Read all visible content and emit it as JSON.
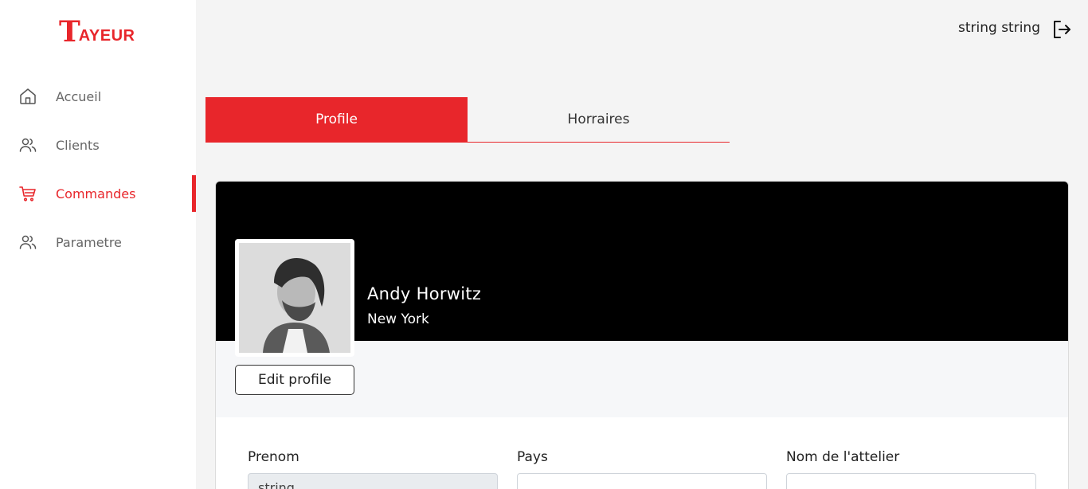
{
  "brand": {
    "logo_initial": "T",
    "logo_rest": "AYEUR",
    "color": "#e8262b"
  },
  "sidebar": {
    "items": [
      {
        "label": "Accueil",
        "icon": "home-icon",
        "active": false
      },
      {
        "label": "Clients",
        "icon": "users-icon",
        "active": false
      },
      {
        "label": "Commandes",
        "icon": "cart-icon",
        "active": true
      },
      {
        "label": "Parametre",
        "icon": "users-icon",
        "active": false
      }
    ]
  },
  "topbar": {
    "user_name": "string string",
    "logout_icon": "logout-icon"
  },
  "tabs": [
    {
      "label": "Profile",
      "active": true
    },
    {
      "label": "Horraires",
      "active": false
    }
  ],
  "profile": {
    "name": "Andy Horwitz",
    "city": "New York",
    "edit_label": "Edit profile"
  },
  "form": {
    "fields": [
      {
        "label": "Prenom",
        "value": "string",
        "disabled": true
      },
      {
        "label": "Pays",
        "value": "",
        "disabled": false
      },
      {
        "label": "Nom de l'attelier",
        "value": "",
        "disabled": false
      }
    ]
  }
}
